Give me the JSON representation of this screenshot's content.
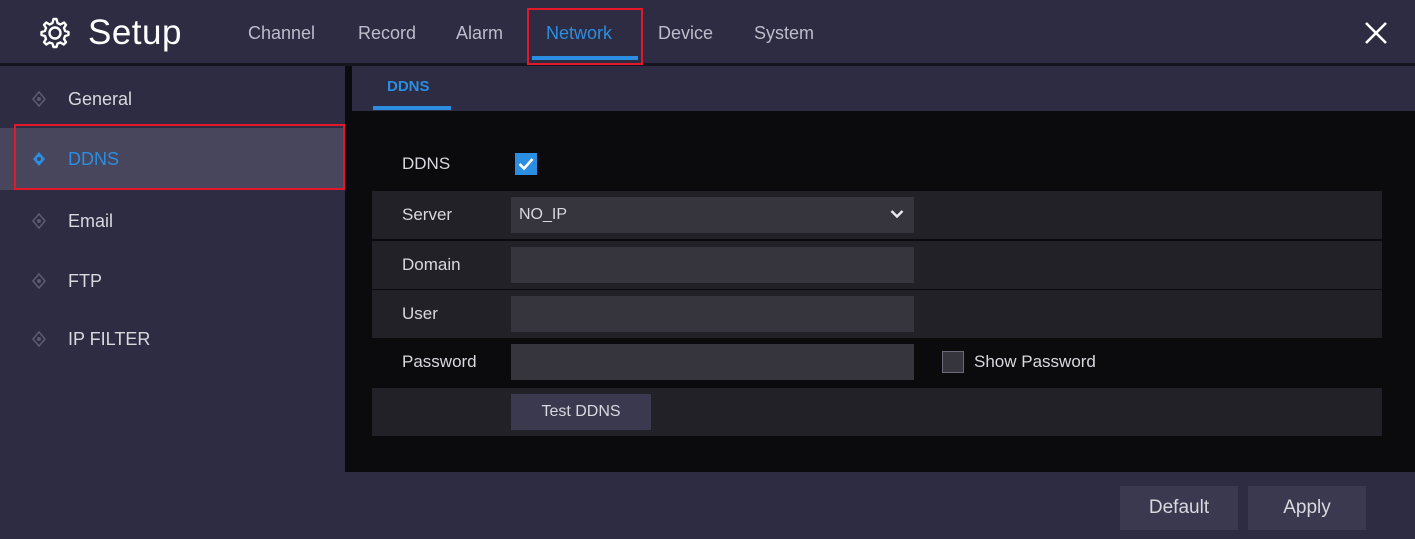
{
  "header": {
    "title": "Setup",
    "gear_icon": "gear-icon",
    "close_icon": "close-icon",
    "menu": [
      {
        "label": "Channel",
        "active": false
      },
      {
        "label": "Record",
        "active": false
      },
      {
        "label": "Alarm",
        "active": false
      },
      {
        "label": "Network",
        "active": true
      },
      {
        "label": "Device",
        "active": false
      },
      {
        "label": "System",
        "active": false
      }
    ]
  },
  "sidebar": {
    "items": [
      {
        "label": "General",
        "active": false
      },
      {
        "label": "DDNS",
        "active": true
      },
      {
        "label": "Email",
        "active": false
      },
      {
        "label": "FTP",
        "active": false
      },
      {
        "label": "IP FILTER",
        "active": false
      }
    ]
  },
  "subtab": {
    "label": "DDNS"
  },
  "form": {
    "ddns_label": "DDNS",
    "ddns_enabled": true,
    "server_label": "Server",
    "server_value": "NO_IP",
    "domain_label": "Domain",
    "domain_value": "",
    "user_label": "User",
    "user_value": "",
    "password_label": "Password",
    "password_value": "",
    "show_password_label": "Show Password",
    "show_password_checked": false,
    "test_button": "Test DDNS"
  },
  "footer": {
    "default_button": "Default",
    "apply_button": "Apply"
  },
  "colors": {
    "accent": "#2b8ee0",
    "highlight_box": "#e3192b",
    "panel": "#2e2c42",
    "background": "#0b0b0e"
  }
}
